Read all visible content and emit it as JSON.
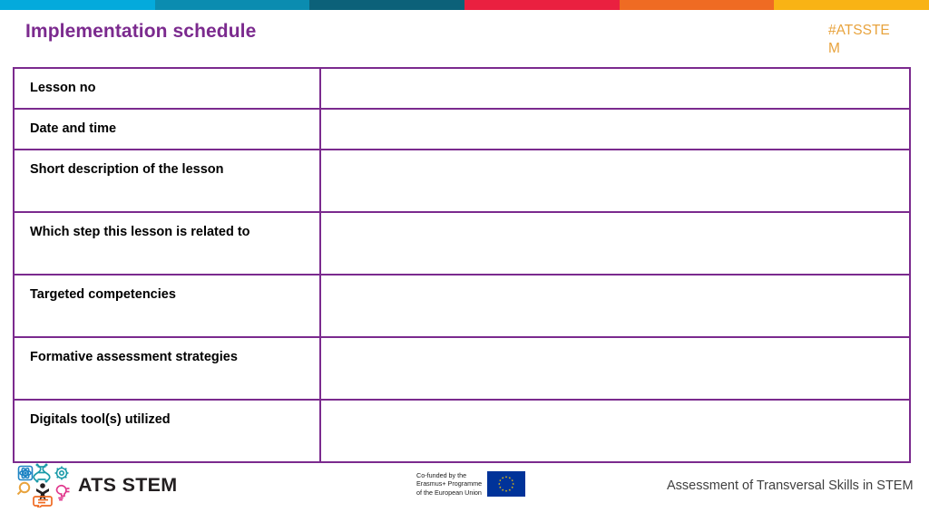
{
  "topbar": {
    "segments": [
      {
        "name": "cyan",
        "color": "#04aadc"
      },
      {
        "name": "teal",
        "color": "#0b8cb0"
      },
      {
        "name": "dark-teal",
        "color": "#0c6179"
      },
      {
        "name": "red",
        "color": "#ea2040"
      },
      {
        "name": "orange",
        "color": "#ef6b23"
      },
      {
        "name": "amber",
        "color": "#f9b315"
      }
    ]
  },
  "header": {
    "title": "Implementation schedule",
    "title_color": "#7b2a8e",
    "hashtag": "#ATSSTEM",
    "hashtag_color": "#e8a33d"
  },
  "table": {
    "border_color": "#7b2a8e",
    "rows": [
      {
        "label": "Lesson no",
        "value": "",
        "size": "short"
      },
      {
        "label": "Date and time",
        "value": "",
        "size": "short"
      },
      {
        "label": "Short description of the lesson",
        "value": "",
        "size": "tall"
      },
      {
        "label": "Which step this lesson is related to",
        "value": "",
        "size": "tall"
      },
      {
        "label": "Targeted competencies",
        "value": "",
        "size": "tall"
      },
      {
        "label": "Formative assessment strategies",
        "value": "",
        "size": "tall"
      },
      {
        "label": "Digitals tool(s) utilized",
        "value": "",
        "size": "tall"
      }
    ]
  },
  "footer": {
    "logo_wordmark": "ATS STEM",
    "logo_icons": [
      "atom-icon",
      "molecule-icon",
      "gear-icon",
      "magnifier-icon",
      "person-icon",
      "lightbulb-icon",
      "speech-bubble-icon"
    ],
    "eu_funding": {
      "line1": "Co-funded by the",
      "line2": "Erasmus+ Programme",
      "line3": "of the European Union",
      "flag_name": "european-union-flag"
    },
    "tagline": "Assessment of Transversal Skills in STEM"
  }
}
